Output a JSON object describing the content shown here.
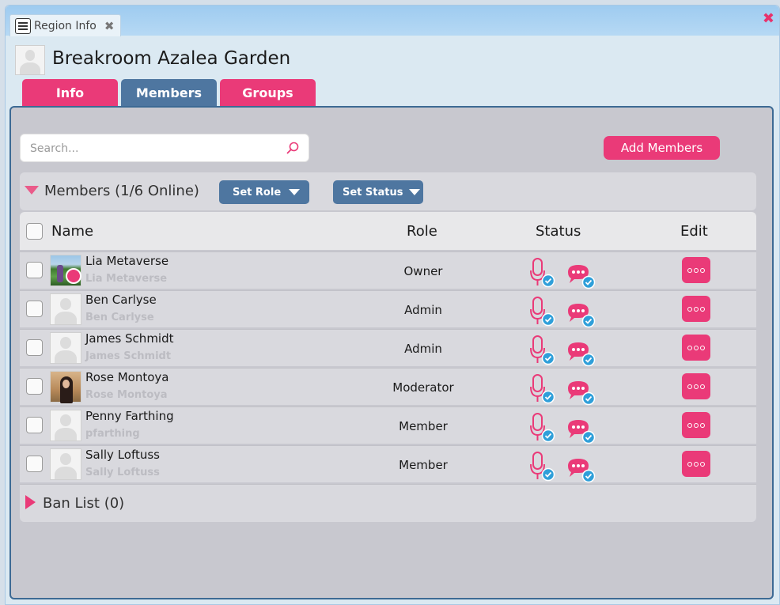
{
  "window": {
    "tab_title": "Region Info",
    "tab_close": "✖",
    "close_glyph": "✖",
    "icon": "region-info-icon"
  },
  "header": {
    "title": "Breakroom Azalea Garden"
  },
  "tabs": [
    {
      "label": "Info",
      "active": false
    },
    {
      "label": "Members",
      "active": true
    },
    {
      "label": "Groups",
      "active": false
    }
  ],
  "search": {
    "placeholder": "Search...",
    "value": ""
  },
  "add_members_label": "Add Members",
  "members_section": {
    "title": "Members (1/6 Online)",
    "set_role_label": "Set Role",
    "set_status_label": "Set Status"
  },
  "table": {
    "headers": {
      "name": "Name",
      "role": "Role",
      "status": "Status",
      "edit": "Edit"
    },
    "rows": [
      {
        "name": "Lia Metaverse",
        "username": "Lia Metaverse",
        "role": "Owner",
        "avatar": "photo-green",
        "online": true
      },
      {
        "name": "Ben Carlyse",
        "username": "Ben Carlyse",
        "role": "Admin",
        "avatar": "default",
        "online": false
      },
      {
        "name": "James Schmidt",
        "username": "James Schmidt",
        "role": "Admin",
        "avatar": "default",
        "online": false
      },
      {
        "name": "Rose Montoya",
        "username": "Rose Montoya",
        "role": "Moderator",
        "avatar": "photo-desert",
        "online": false
      },
      {
        "name": "Penny Farthing",
        "username": "pfarthing",
        "role": "Member",
        "avatar": "default",
        "online": false
      },
      {
        "name": "Sally Loftuss",
        "username": "Sally Loftuss",
        "role": "Member",
        "avatar": "default",
        "online": false
      }
    ]
  },
  "ban_list": {
    "title": "Ban List (0)"
  },
  "colors": {
    "accent_pink": "#ea3a78",
    "tab_blue": "#4e76a0",
    "panel_border": "#3d6a94",
    "check_blue": "#2f9fd9"
  }
}
